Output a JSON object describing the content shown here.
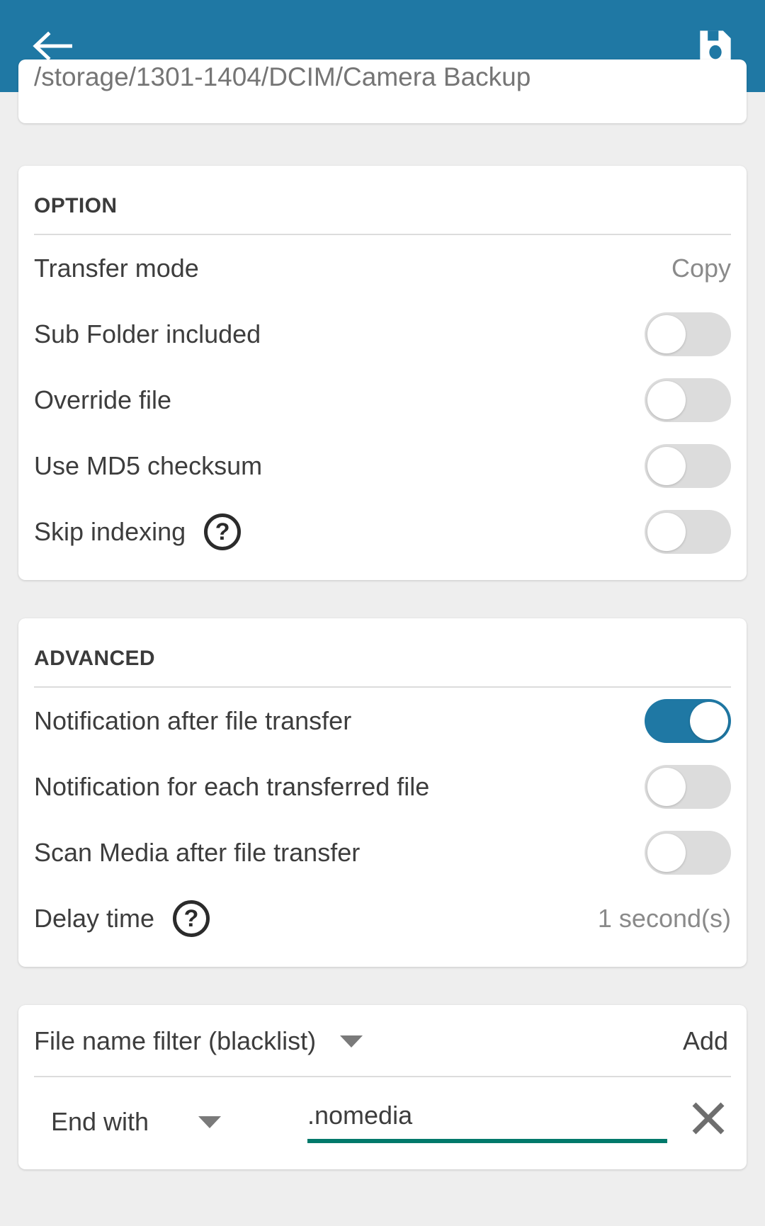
{
  "appbar": {
    "back_icon": "back-arrow-icon",
    "save_icon": "save-floppy-icon",
    "color": "#1f78a4"
  },
  "path": {
    "value": "/storage/1301-1404/DCIM/Camera Backup"
  },
  "option_section": {
    "title": "OPTION",
    "rows": [
      {
        "label": "Transfer mode",
        "value": "Copy",
        "type": "value"
      },
      {
        "label": "Sub Folder included",
        "type": "toggle",
        "on": false
      },
      {
        "label": "Override file",
        "type": "toggle",
        "on": false
      },
      {
        "label": "Use MD5 checksum",
        "type": "toggle",
        "on": false
      },
      {
        "label": "Skip indexing",
        "type": "toggle",
        "on": false,
        "help": "?"
      }
    ]
  },
  "advanced_section": {
    "title": "ADVANCED",
    "rows": [
      {
        "label": "Notification after file transfer",
        "type": "toggle",
        "on": true
      },
      {
        "label": "Notification for each transferred file",
        "type": "toggle",
        "on": false
      },
      {
        "label": "Scan Media after file transfer",
        "type": "toggle",
        "on": false
      },
      {
        "label": "Delay time",
        "value": "1 second(s)",
        "type": "value",
        "help": "?"
      }
    ]
  },
  "filter_section": {
    "filter_kind_label": "File name filter (blacklist)",
    "add_label": "Add",
    "rule": {
      "match_type": "End with",
      "pattern": ".nomedia",
      "pattern_placeholder": "",
      "underline_color": "#00796b"
    }
  }
}
